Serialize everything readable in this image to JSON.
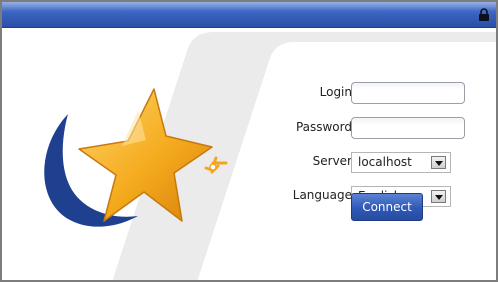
{
  "window": {
    "lock_icon": "lock-icon"
  },
  "logo": {
    "icon": "star-logo-icon",
    "colors": {
      "star": "#f3a91c",
      "swoosh": "#1f3f8f"
    }
  },
  "form": {
    "login": {
      "label": "Login",
      "value": ""
    },
    "password": {
      "label": "Password",
      "value": ""
    },
    "server": {
      "label": "Server",
      "value": "localhost"
    },
    "language": {
      "label": "Language",
      "value": "English"
    },
    "connect_label": "Connect"
  },
  "colors": {
    "titlebar": "#3a63c1",
    "button": "#2f59b8"
  }
}
